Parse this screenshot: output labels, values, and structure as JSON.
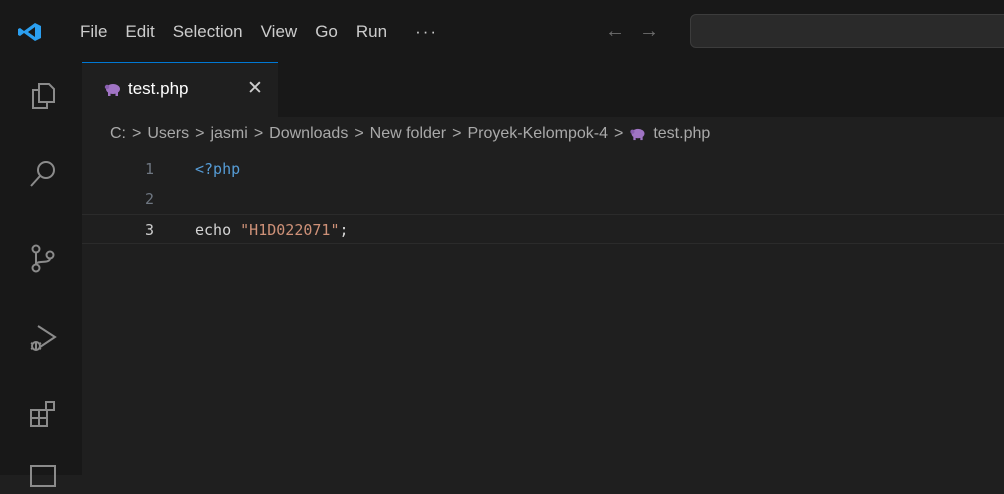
{
  "menu": {
    "items": [
      "File",
      "Edit",
      "Selection",
      "View",
      "Go",
      "Run"
    ],
    "more": "···"
  },
  "nav": {
    "back": "←",
    "forward": "→"
  },
  "tab": {
    "label": "test.php",
    "close": "✕"
  },
  "breadcrumb": {
    "items": [
      "C:",
      "Users",
      "jasmi",
      "Downloads",
      "New folder",
      "Proyek-Kelompok-4"
    ],
    "file": "test.php",
    "separator": ">"
  },
  "editor": {
    "lines": [
      {
        "number": "1",
        "tokens": [
          {
            "text": "<?php",
            "kind": "tag"
          }
        ]
      },
      {
        "number": "2",
        "tokens": []
      },
      {
        "number": "3",
        "tokens": [
          {
            "text": "echo ",
            "kind": "kw"
          },
          {
            "text": "\"H1D022071\"",
            "kind": "str"
          },
          {
            "text": ";",
            "kind": "punc"
          }
        ]
      }
    ],
    "current_line": "3"
  },
  "colors": {
    "accent": "#0078d4",
    "php_icon": "#a074c4",
    "string": "#ce9178",
    "tag": "#569cd6"
  }
}
